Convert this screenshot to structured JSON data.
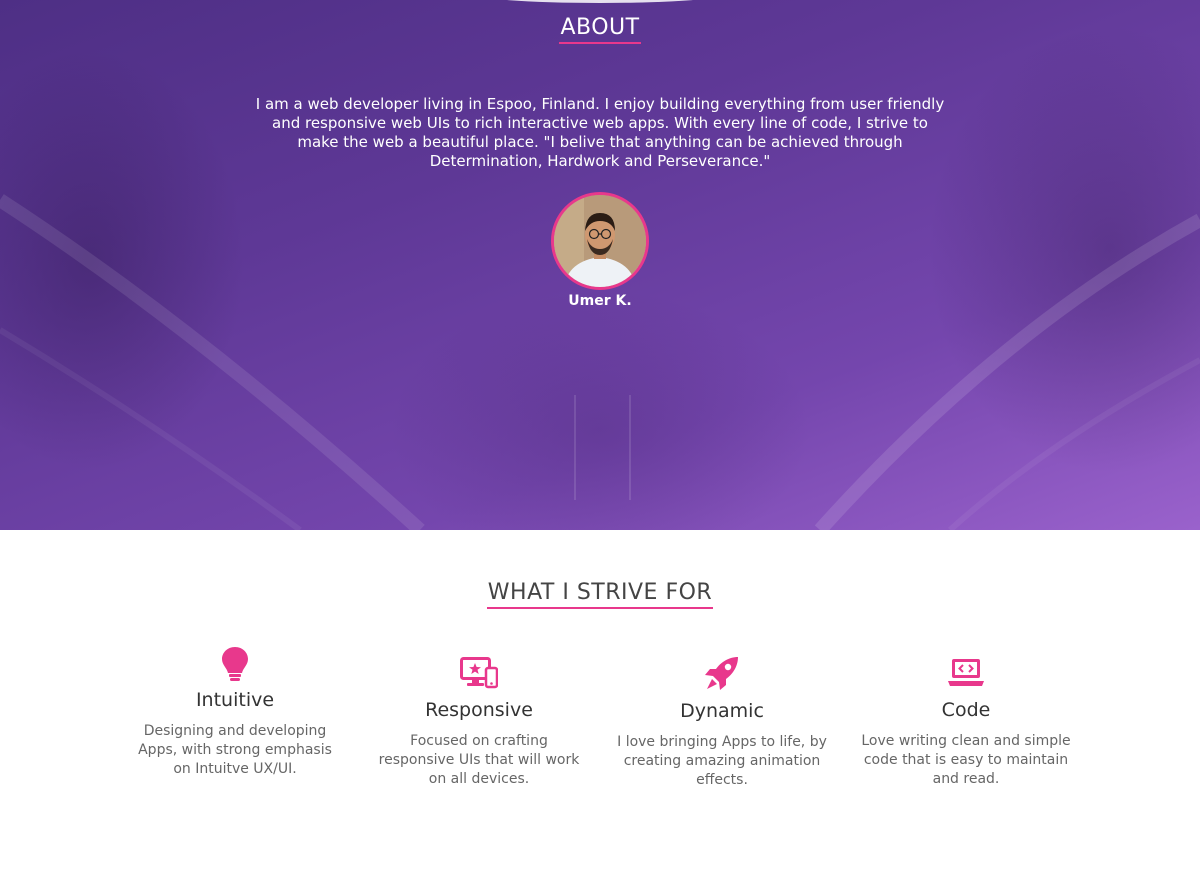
{
  "about": {
    "title": "ABOUT",
    "description": "I am a web developer living in Espoo, Finland. I enjoy building everything from user friendly and responsive web UIs to rich interactive web apps. With every line of code, I strive to make the web a beautiful place. \"I belive that anything can be achieved through Determination, Hardwork and Perseverance.\"",
    "author": "Umer K."
  },
  "strive": {
    "title": "WHAT I STRIVE FOR",
    "features": [
      {
        "icon": "lightbulb-icon",
        "title": "Intuitive",
        "text": "Designing and developing Apps, with strong emphasis on Intuitve UX/UI."
      },
      {
        "icon": "responsive-devices-icon",
        "title": "Responsive",
        "text": "Focused on crafting responsive UIs that will work on all devices."
      },
      {
        "icon": "rocket-icon",
        "title": "Dynamic",
        "text": "I love bringing Apps to life, by creating amazing animation effects."
      },
      {
        "icon": "code-laptop-icon",
        "title": "Code",
        "text": "Love writing clean and simple code that is easy to maintain and read."
      }
    ]
  },
  "colors": {
    "accent": "#e8388c",
    "hero_purple": "#5e3896",
    "heading_text": "#333333",
    "body_text": "#666666"
  }
}
